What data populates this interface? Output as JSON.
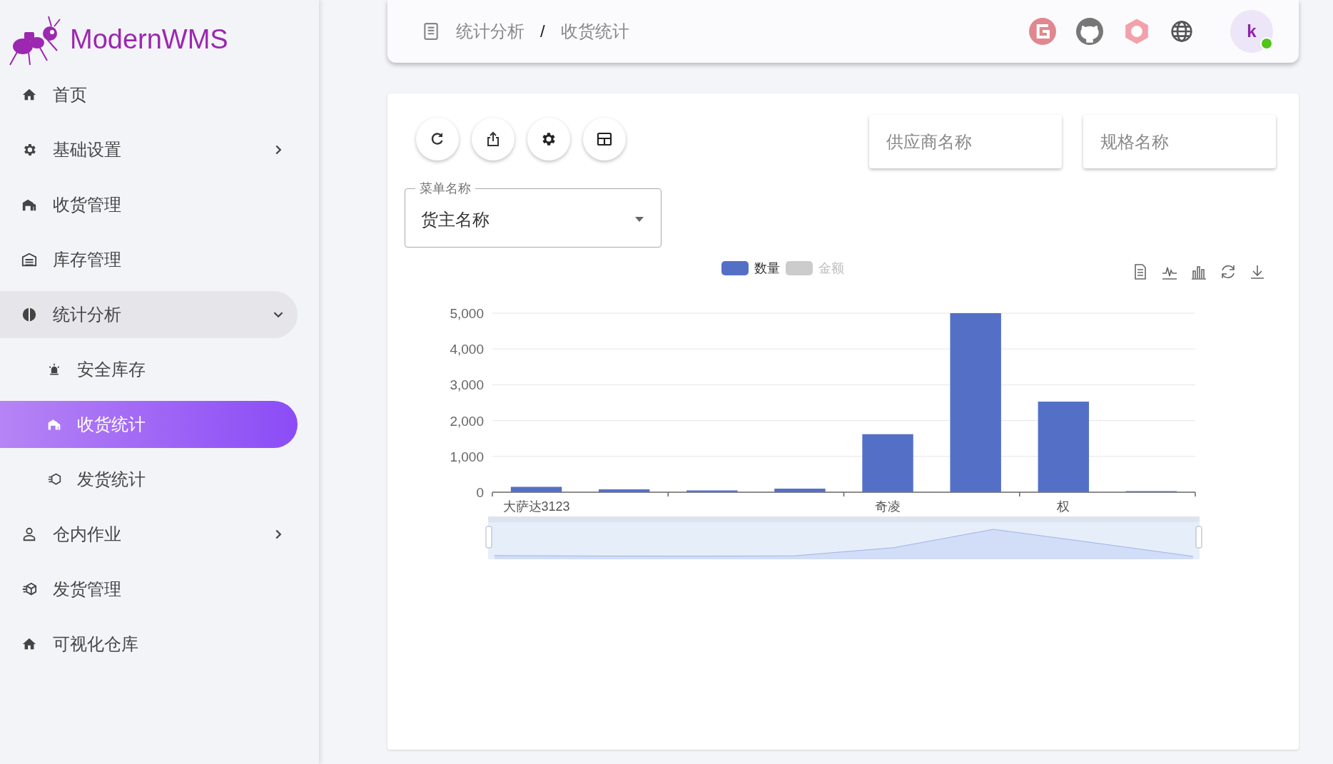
{
  "brand": {
    "name": "ModernWMS"
  },
  "sidebar": {
    "items": [
      {
        "label": "首页",
        "kind": "link",
        "selected": false
      },
      {
        "label": "基础设置",
        "kind": "group",
        "expanded": false,
        "selected": false
      },
      {
        "label": "收货管理",
        "kind": "link",
        "selected": false
      },
      {
        "label": "库存管理",
        "kind": "link",
        "selected": false
      },
      {
        "label": "统计分析",
        "kind": "group",
        "expanded": true,
        "selected": false,
        "children": [
          {
            "label": "安全库存",
            "selected": false
          },
          {
            "label": "收货统计",
            "selected": true
          },
          {
            "label": "发货统计",
            "selected": false
          }
        ]
      },
      {
        "label": "仓内作业",
        "kind": "group",
        "expanded": false,
        "selected": false
      },
      {
        "label": "发货管理",
        "kind": "link",
        "selected": false
      },
      {
        "label": "可视化仓库",
        "kind": "link",
        "selected": false
      }
    ]
  },
  "topbar": {
    "breadcrumb": [
      "统计分析",
      "收货统计"
    ],
    "separator": "/",
    "avatar": {
      "letter": "k",
      "online": true
    }
  },
  "filters": {
    "supplier": {
      "placeholder": "供应商名称"
    },
    "spec": {
      "placeholder": "规格名称"
    },
    "menu_select": {
      "label": "菜单名称",
      "value": "货主名称"
    }
  },
  "chart": {
    "legend": [
      {
        "selected": true
      },
      {
        "selected": false
      }
    ],
    "chart_data": {
      "type": "bar",
      "grid": true,
      "categories": [
        "大萨达3123",
        null,
        null,
        null,
        "奇凌",
        null,
        "权",
        null
      ],
      "series": [
        {
          "name": "数量",
          "color": "#5470c6",
          "values": [
            150,
            80,
            50,
            100,
            1620,
            5000,
            2530,
            10
          ]
        },
        {
          "name": "金额",
          "values": [
            null,
            null,
            null,
            null,
            null,
            null,
            null,
            null
          ]
        }
      ],
      "ylim": [
        0,
        5000
      ],
      "yticks": [
        {
          "value": 0,
          "label": "0"
        },
        {
          "value": 1000,
          "label": "1,000"
        },
        {
          "value": 2000,
          "label": "2,000"
        },
        {
          "value": 3000,
          "label": "3,000"
        },
        {
          "value": 4000,
          "label": "4,000"
        },
        {
          "value": 5000,
          "label": "5,000"
        }
      ]
    }
  }
}
